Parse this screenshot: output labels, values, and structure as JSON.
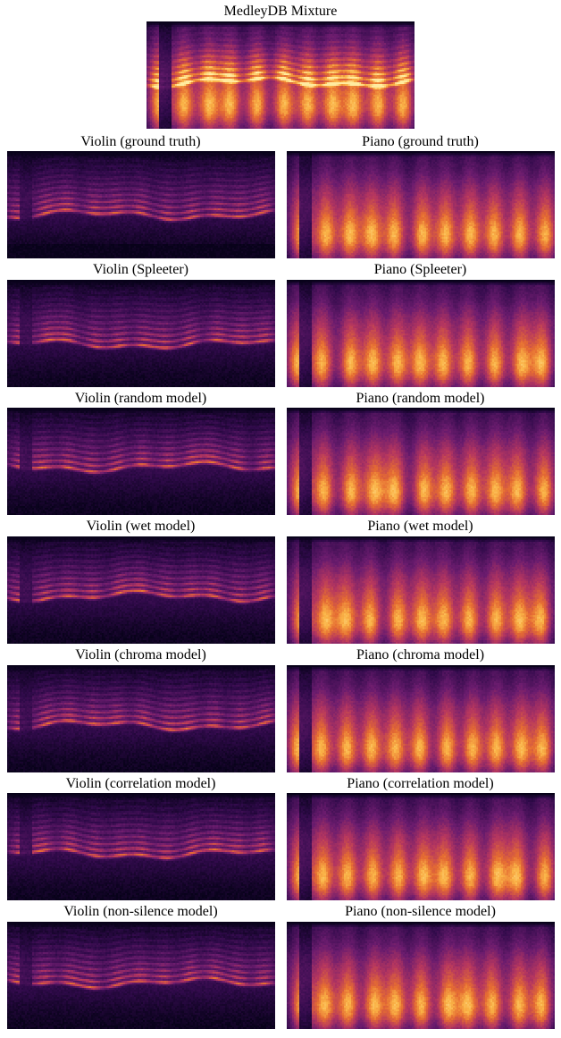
{
  "top": {
    "label": "MedleyDB Mixture"
  },
  "rows": [
    {
      "left": "Violin (ground truth)",
      "right": "Piano (ground truth)"
    },
    {
      "left": "Violin (Spleeter)",
      "right": "Piano (Spleeter)"
    },
    {
      "left": "Violin (random model)",
      "right": "Piano (random model)"
    },
    {
      "left": "Violin (wet model)",
      "right": "Piano (wet model)"
    },
    {
      "left": "Violin (chroma model)",
      "right": "Piano (chroma model)"
    },
    {
      "left": "Violin (correlation model)",
      "right": "Piano (correlation model)"
    },
    {
      "left": "Violin (non-silence model)",
      "right": "Piano (non-silence model)"
    }
  ],
  "colors": {
    "spectro_dark": "#12021a",
    "spectro_mid": "#6b1c6e",
    "spectro_hi": "#f39c12",
    "spectro_bright": "#ffe08a"
  }
}
